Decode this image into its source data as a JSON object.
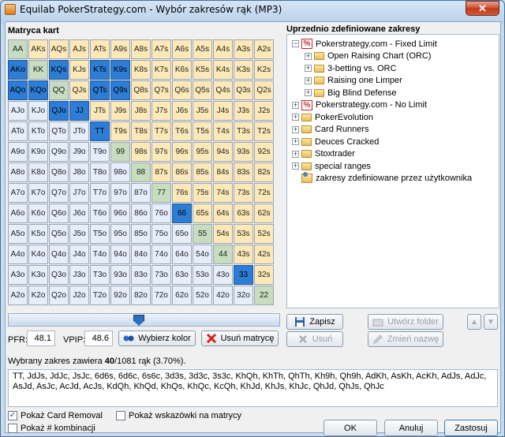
{
  "window": {
    "title": "Equilab PokerStrategy.com - Wybór zakresów rąk (MP3)",
    "close": "✕"
  },
  "matrix": {
    "label": "Matryca kart",
    "selected": [
      "TT",
      "JJ",
      "QQ",
      "KK",
      "AKs",
      "KQs",
      "KTs",
      "K9s",
      "QJs",
      "QTs",
      "Q9s",
      "JJ",
      "AKo",
      "KQo",
      "QJo",
      "JTs",
      "J9s",
      "66",
      "33"
    ],
    "rows": [
      [
        "AA",
        "AKs",
        "AQs",
        "AJs",
        "ATs",
        "A9s",
        "A8s",
        "A7s",
        "A6s",
        "A5s",
        "A4s",
        "A3s",
        "A2s"
      ],
      [
        "AKo",
        "KK",
        "KQs",
        "KJs",
        "KTs",
        "K9s",
        "K8s",
        "K7s",
        "K6s",
        "K5s",
        "K4s",
        "K3s",
        "K2s"
      ],
      [
        "AQo",
        "KQo",
        "QQ",
        "QJs",
        "QTs",
        "Q9s",
        "Q8s",
        "Q7s",
        "Q6s",
        "Q5s",
        "Q4s",
        "Q3s",
        "Q2s"
      ],
      [
        "AJo",
        "KJo",
        "QJo",
        "JJ",
        "JTs",
        "J9s",
        "J8s",
        "J7s",
        "J6s",
        "J5s",
        "J4s",
        "J3s",
        "J2s"
      ],
      [
        "ATo",
        "KTo",
        "QTo",
        "JTo",
        "TT",
        "T9s",
        "T8s",
        "T7s",
        "T6s",
        "T5s",
        "T4s",
        "T3s",
        "T2s"
      ],
      [
        "A9o",
        "K9o",
        "Q9o",
        "J9o",
        "T9o",
        "99",
        "98s",
        "97s",
        "96s",
        "95s",
        "94s",
        "93s",
        "92s"
      ],
      [
        "A8o",
        "K8o",
        "Q8o",
        "J8o",
        "T8o",
        "98o",
        "88",
        "87s",
        "86s",
        "85s",
        "84s",
        "83s",
        "82s"
      ],
      [
        "A7o",
        "K7o",
        "Q7o",
        "J7o",
        "T7o",
        "97o",
        "87o",
        "77",
        "76s",
        "75s",
        "74s",
        "73s",
        "72s"
      ],
      [
        "A6o",
        "K6o",
        "Q6o",
        "J6o",
        "T6o",
        "96o",
        "86o",
        "76o",
        "66",
        "65s",
        "64s",
        "63s",
        "62s"
      ],
      [
        "A5o",
        "K5o",
        "Q5o",
        "J5o",
        "T5o",
        "95o",
        "85o",
        "75o",
        "65o",
        "55",
        "54s",
        "53s",
        "52s"
      ],
      [
        "A4o",
        "K4o",
        "Q4o",
        "J4o",
        "T4o",
        "94o",
        "84o",
        "74o",
        "64o",
        "54o",
        "44",
        "43s",
        "42s"
      ],
      [
        "A3o",
        "K3o",
        "Q3o",
        "J3o",
        "T3o",
        "93o",
        "83o",
        "73o",
        "63o",
        "53o",
        "43o",
        "33",
        "32s"
      ],
      [
        "A2o",
        "K2o",
        "Q2o",
        "J2o",
        "T2o",
        "92o",
        "82o",
        "72o",
        "62o",
        "52o",
        "42o",
        "32o",
        "22"
      ]
    ]
  },
  "selected_cells": [
    "AKo",
    "KQs",
    "KTs",
    "K9s",
    "AQo",
    "KQo",
    "QTs",
    "Q9s",
    "QJo",
    "JJ",
    "TT",
    "66",
    "33",
    "QJs_x"
  ],
  "slider": {
    "level_percent": 48.1
  },
  "controls": {
    "pfr_label": "PFR:",
    "pfr_value": "48.1",
    "vpip_label": "VPIP:",
    "vpip_value": "48.6",
    "color_button": "Wybierz kolor",
    "clear_button": "Usuń matrycę"
  },
  "summary": {
    "prefix": "Wybrany zakres zawiera",
    "count": "40",
    "suffix": "/1081 rąk (3.70%)."
  },
  "combos_text": "TT, JdJs, JdJc, JsJc, 6d6s, 6d6c, 6s6c, 3d3s, 3d3c, 3s3c, KhQh, KhTh, QhTh, Kh9h, Qh9h, AdKh, AsKh, AcKh, AdJs, AdJc, AsJd, AsJc, AcJd, AcJs, KdQh, KhQd, KhQs, KhQc, KcQh, KhJd, KhJs, KhJc, QhJd, QhJs, QhJc",
  "checkboxes": {
    "card_removal": {
      "label": "Pokaż Card Removal",
      "checked": true
    },
    "combinations": {
      "label": "Pokaż # kombinacji",
      "checked": false
    },
    "hints": {
      "label": "Pokaż wskazówki na matrycy",
      "checked": false
    }
  },
  "ranges": {
    "label": "Uprzednio zdefiniowane zakresy",
    "tree": [
      {
        "label": "Pokerstrategy.com - Fixed Limit",
        "icon": "ps-icon",
        "expander": "−",
        "indent": 0
      },
      {
        "label": "Open Raising Chart (ORC)",
        "icon": "folder-icon",
        "expander": "+",
        "indent": 1
      },
      {
        "label": "3-betting vs. ORC",
        "icon": "folder-icon",
        "expander": "+",
        "indent": 1
      },
      {
        "label": "Raising one Limper",
        "icon": "folder-icon",
        "expander": "+",
        "indent": 1
      },
      {
        "label": "Big Blind Defense",
        "icon": "folder-icon",
        "expander": "+",
        "indent": 1
      },
      {
        "label": "Pokerstrategy.com - No Limit",
        "icon": "ps-icon",
        "expander": "+",
        "indent": 0
      },
      {
        "label": "PokerEvolution",
        "icon": "folder-icon",
        "expander": "+",
        "indent": 0
      },
      {
        "label": "Card Runners",
        "icon": "folder-icon",
        "expander": "+",
        "indent": 0
      },
      {
        "label": "Deuces Cracked",
        "icon": "folder-icon",
        "expander": "+",
        "indent": 0
      },
      {
        "label": "Stoxtrader",
        "icon": "folder-icon",
        "expander": "+",
        "indent": 0
      },
      {
        "label": "special ranges",
        "icon": "folder-icon",
        "expander": "+",
        "indent": 0
      },
      {
        "label": "zakresy zdefiniowane przez użytkownika",
        "icon": "user-folder-icon",
        "expander": "",
        "indent": 0
      }
    ],
    "buttons": {
      "save": "Zapisz",
      "delete": "Usuń",
      "new_folder": "Utwórz folder",
      "rename": "Zmień nazwę"
    }
  },
  "footer": {
    "ok": "OK",
    "cancel": "Anuluj",
    "apply": "Zastosuj"
  }
}
